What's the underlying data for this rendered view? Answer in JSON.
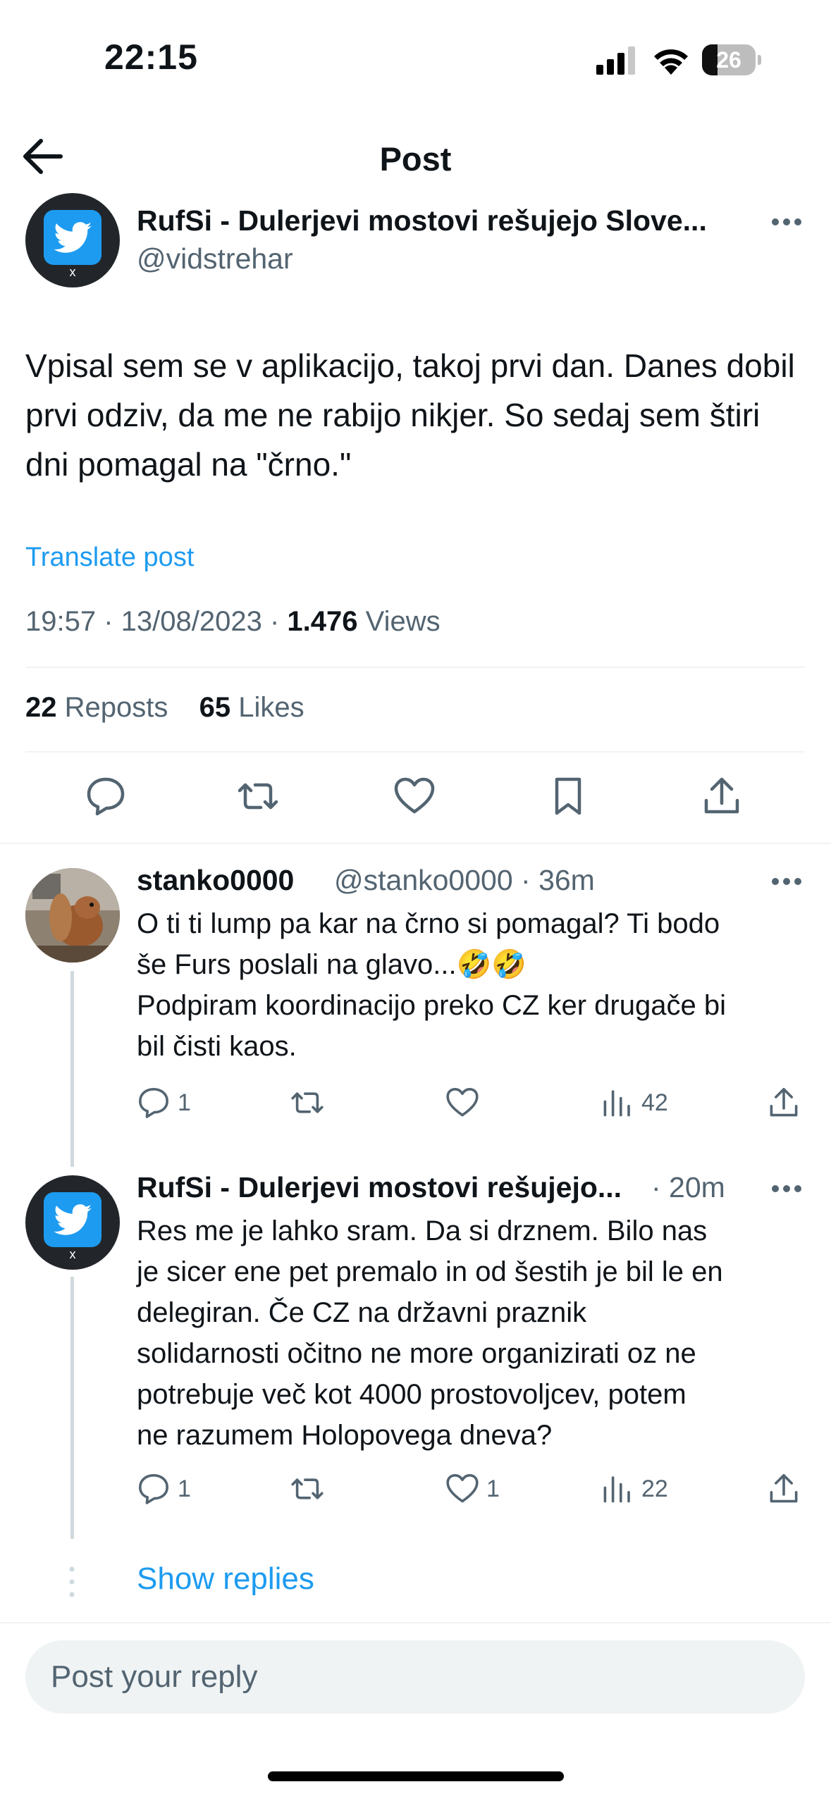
{
  "status_bar": {
    "time": "22:15",
    "battery_level": "26",
    "icons": [
      "signal-icon",
      "wifi-icon",
      "battery-icon"
    ]
  },
  "header": {
    "title": "Post",
    "back_icon": "arrow-left-icon"
  },
  "main_post": {
    "author_name": "RufSi - Dulerjevi mostovi rešujejo Slove...",
    "handle": "@vidstrehar",
    "text": "Vpisal sem se v aplikacijo, takoj prvi dan. Danes dobil prvi odziv, da me ne rabijo nikjer. So sedaj sem štiri dni pomagal na \"črno.\"",
    "translate_label": "Translate post",
    "time": "19:57",
    "date": "13/08/2023",
    "views_count": "1.476",
    "views_label": "Views",
    "reposts_count": "22",
    "reposts_label": "Reposts",
    "likes_count": "65",
    "likes_label": "Likes",
    "actions": [
      "reply-icon",
      "repost-icon",
      "like-icon",
      "bookmark-icon",
      "share-icon"
    ]
  },
  "replies": [
    {
      "author_name": "stanko0000",
      "handle": "@stanko0000",
      "time": "36m",
      "text_lines": [
        "O ti ti lump pa kar na črno si pomagal? Ti bodo",
        "še Furs poslali na glavo...🤣🤣",
        "Podpiram koordinacijo preko CZ ker drugače bi",
        "bil čisti kaos."
      ],
      "reply_count": "1",
      "repost_count": "",
      "like_count": "",
      "views": "42"
    },
    {
      "author_name": "RufSi - Dulerjevi mostovi rešujejo...",
      "handle": "",
      "time": "20m",
      "text_lines": [
        "Res me je lahko sram. Da si drznem. Bilo nas",
        "je sicer ene pet premalo in od šestih je bil le en",
        "delegiran. Če CZ na državni praznik",
        "solidarnosti očitno ne more organizirati oz ne",
        "potrebuje več kot 4000 prostovoljcev, potem",
        "ne razumem Holopovega dneva?"
      ],
      "reply_count": "1",
      "repost_count": "",
      "like_count": "1",
      "views": "22"
    }
  ],
  "show_replies_label": "Show replies",
  "reply_box": {
    "placeholder": "Post your reply"
  },
  "colors": {
    "accent": "#1d9bf0",
    "text": "#0f1419",
    "secondary": "#536471",
    "divider": "#eff3f4"
  }
}
